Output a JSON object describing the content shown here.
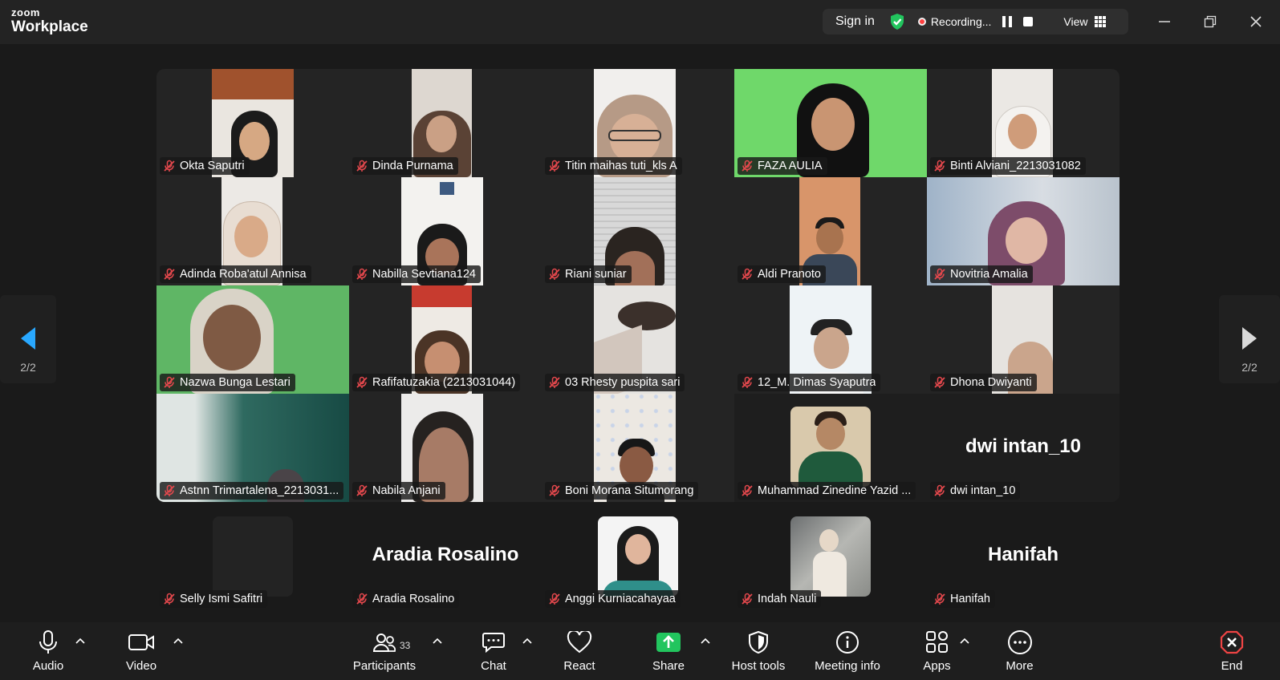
{
  "app": {
    "logo_line1": "zoom",
    "logo_line2": "Workplace",
    "accent_color": "#0e72ed"
  },
  "top_controls": {
    "sign_in": "Sign in",
    "shield_color": "#22c55e",
    "recording_label": "Recording...",
    "view_label": "View"
  },
  "pager": {
    "left_page": "2/2",
    "right_page": "2/2"
  },
  "participants": [
    {
      "name": "Okta Saputri",
      "muted": true
    },
    {
      "name": "Dinda Purnama",
      "muted": true
    },
    {
      "name": "Titin maihas tuti_kls A",
      "muted": true
    },
    {
      "name": "FAZA AULIA",
      "muted": true
    },
    {
      "name": "Binti Alviani_2213031082",
      "muted": true
    },
    {
      "name": "Adinda Roba'atul Annisa",
      "muted": true
    },
    {
      "name": "Nabilla Sevtiana124",
      "muted": true
    },
    {
      "name": "Riani suniar",
      "muted": true
    },
    {
      "name": "Aldi Pranoto",
      "muted": true
    },
    {
      "name": "Novitria Amalia",
      "muted": true
    },
    {
      "name": "Nazwa Bunga Lestari",
      "muted": true
    },
    {
      "name": "Rafifatuzakia (2213031044)",
      "muted": true
    },
    {
      "name": "03 Rhesty puspita sari",
      "muted": true
    },
    {
      "name": "12_M. Dimas Syaputra",
      "muted": true
    },
    {
      "name": "Dhona Dwiyanti",
      "muted": true
    },
    {
      "name": "Astnn Trimartalena_2213031...",
      "muted": true
    },
    {
      "name": "Nabila Anjani",
      "muted": true
    },
    {
      "name": "Boni Morana Situmorang",
      "muted": true
    },
    {
      "name": "Muhammad Zinedine Yazid ...",
      "muted": true
    },
    {
      "name": "dwi intan_10",
      "muted": true,
      "big_name": "dwi intan_10"
    },
    {
      "name": "Selly Ismi Safitri",
      "muted": true
    },
    {
      "name": "Aradia Rosalino",
      "muted": true,
      "big_name": "Aradia Rosalino"
    },
    {
      "name": "Anggi Kurniacahayaa",
      "muted": true
    },
    {
      "name": "Indah Nauli",
      "muted": true
    },
    {
      "name": "Hanifah",
      "muted": true,
      "big_name": "Hanifah"
    }
  ],
  "toolbar": {
    "audio": "Audio",
    "video": "Video",
    "participants": "Participants",
    "participants_count": "33",
    "chat": "Chat",
    "react": "React",
    "share": "Share",
    "host_tools": "Host tools",
    "meeting_info": "Meeting info",
    "apps": "Apps",
    "more": "More",
    "end": "End",
    "share_color": "#22c55e",
    "end_color": "#ef4444",
    "muted_color": "#e5484d"
  }
}
